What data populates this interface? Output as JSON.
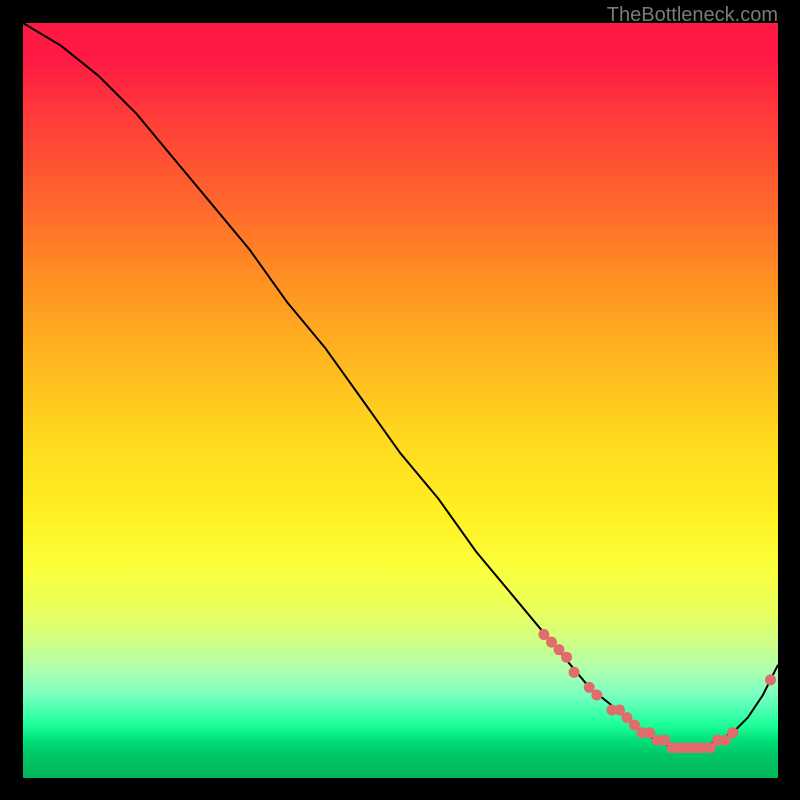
{
  "watermark": "TheBottleneck.com",
  "chart_data": {
    "type": "line",
    "title": "",
    "xlabel": "",
    "ylabel": "",
    "xlim": [
      0,
      100
    ],
    "ylim": [
      0,
      100
    ],
    "series": [
      {
        "name": "curve",
        "x": [
          0,
          5,
          10,
          15,
          20,
          25,
          30,
          35,
          40,
          45,
          50,
          55,
          60,
          65,
          70,
          75,
          80,
          82,
          84,
          86,
          88,
          90,
          92,
          94,
          96,
          98,
          100
        ],
        "values": [
          100,
          97,
          93,
          88,
          82,
          76,
          70,
          63,
          57,
          50,
          43,
          37,
          30,
          24,
          18,
          12,
          8,
          6,
          5,
          4,
          4,
          4,
          5,
          6,
          8,
          11,
          15
        ]
      },
      {
        "name": "highlight-points",
        "x": [
          69,
          70,
          71,
          72,
          73,
          75,
          76,
          78,
          79,
          80,
          81,
          82,
          83,
          84,
          85,
          86,
          87,
          88,
          89,
          90,
          91,
          92,
          93,
          94,
          99
        ],
        "values": [
          19,
          18,
          17,
          16,
          14,
          12,
          11,
          9,
          9,
          8,
          7,
          6,
          6,
          5,
          5,
          4,
          4,
          4,
          4,
          4,
          4,
          5,
          5,
          6,
          13
        ]
      }
    ],
    "colors": {
      "curve": "#000000",
      "points": "#e06c6c"
    }
  }
}
